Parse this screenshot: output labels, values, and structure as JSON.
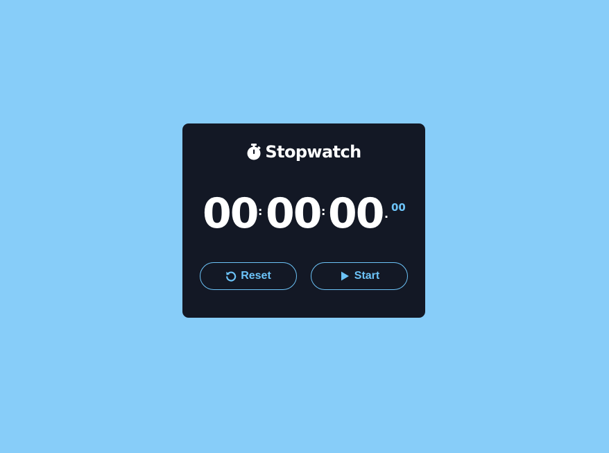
{
  "app": {
    "title": "Stopwatch",
    "title_icon": "stopwatch-icon"
  },
  "timer": {
    "hours": "00",
    "minutes": "00",
    "seconds": "00",
    "hundredths": "00",
    "separator_1": ":",
    "separator_2": ":",
    "separator_3": "."
  },
  "buttons": {
    "reset_label": "Reset",
    "reset_icon": "rotate-left-icon",
    "start_label": "Start",
    "start_icon": "play-icon"
  },
  "colors": {
    "page_background": "#87cdf9",
    "card_background": "#131825",
    "accent": "#6cc3f8",
    "text": "#ffffff"
  }
}
